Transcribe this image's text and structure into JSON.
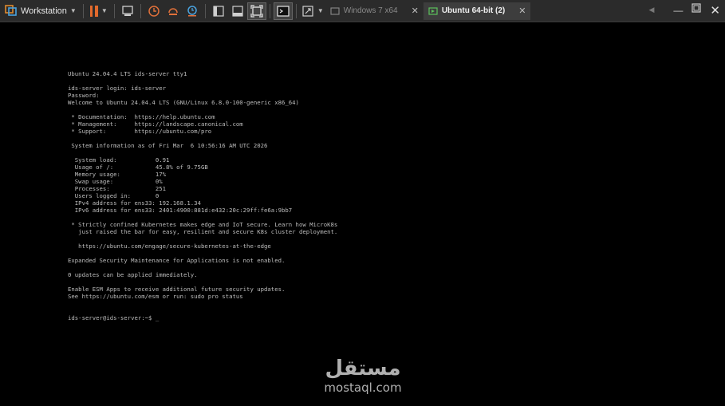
{
  "toolbar": {
    "app_label": "Workstation",
    "tabs": [
      {
        "label": "Windows 7 x64",
        "active": false
      },
      {
        "label": "Ubuntu 64-bit (2)",
        "active": true
      }
    ]
  },
  "terminal": {
    "lines": [
      "Ubuntu 24.04.4 LTS ids-server tty1",
      "",
      "ids-server login: ids-server",
      "Password:",
      "Welcome to Ubuntu 24.04.4 LTS (GNU/Linux 6.8.0-100-generic x86_64)",
      "",
      " * Documentation:  https://help.ubuntu.com",
      " * Management:     https://landscape.canonical.com",
      " * Support:        https://ubuntu.com/pro",
      "",
      " System information as of Fri Mar  6 10:56:16 AM UTC 2026",
      "",
      "  System load:           0.91",
      "  Usage of /:            45.8% of 9.75GB",
      "  Memory usage:          17%",
      "  Swap usage:            0%",
      "  Processes:             251",
      "  Users logged in:       0",
      "  IPv4 address for ens33: 192.168.1.34",
      "  IPv6 address for ens33: 2401:4900:881d:e432:20c:29ff:fe6a:9bb7",
      "",
      " * Strictly confined Kubernetes makes edge and IoT secure. Learn how MicroK8s",
      "   just raised the bar for easy, resilient and secure K8s cluster deployment.",
      "",
      "   https://ubuntu.com/engage/secure-kubernetes-at-the-edge",
      "",
      "Expanded Security Maintenance for Applications is not enabled.",
      "",
      "0 updates can be applied immediately.",
      "",
      "Enable ESM Apps to receive additional future security updates.",
      "See https://ubuntu.com/esm or run: sudo pro status",
      "",
      "",
      "ids-server@ids-server:~$ _"
    ]
  },
  "watermark": {
    "arabic": "مستقل",
    "latin": "mostaql.com"
  },
  "colors": {
    "toolbar_bg": "#2b2b2b",
    "pause_accent": "#e26a2c",
    "terminal_text": "#bdbdbd",
    "terminal_bg": "#000000"
  }
}
